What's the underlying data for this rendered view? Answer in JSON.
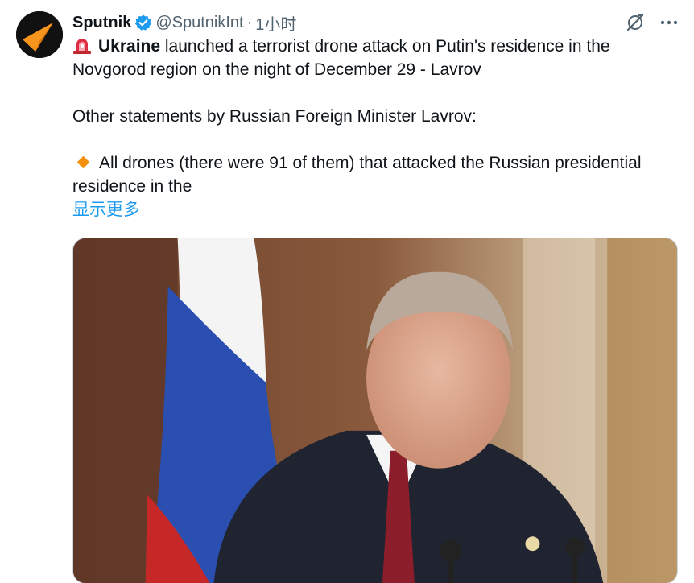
{
  "author": {
    "name": "Sputnik",
    "handle": "@SputnikInt",
    "separator": "·",
    "time": "1小时",
    "verified": true,
    "avatar_icon": "sputnik-logo-icon"
  },
  "actions": {
    "grok_icon": "grok-icon",
    "more_icon": "more-horizontal-icon"
  },
  "tweet": {
    "headline_bold": "Ukraine",
    "headline_rest": " launched a terrorist drone attack on Putin's residence in the Novgorod region on the night of December 29  - Lavrov",
    "statements_intro": "Other statements by Russian Foreign Minister Lavrov:",
    "bullet_text": "All drones (there were 91 of them) that attacked the Russian presidential residence in the",
    "show_more": "显示更多",
    "siren_icon": "rotating-light-icon",
    "bullet_icon": "orange-diamond-icon"
  },
  "colors": {
    "accent": "#1d9bf0",
    "text": "#0f1419",
    "muted": "#536471",
    "verified": "#1d9bf0",
    "avatar_orange": "#f7941d"
  }
}
